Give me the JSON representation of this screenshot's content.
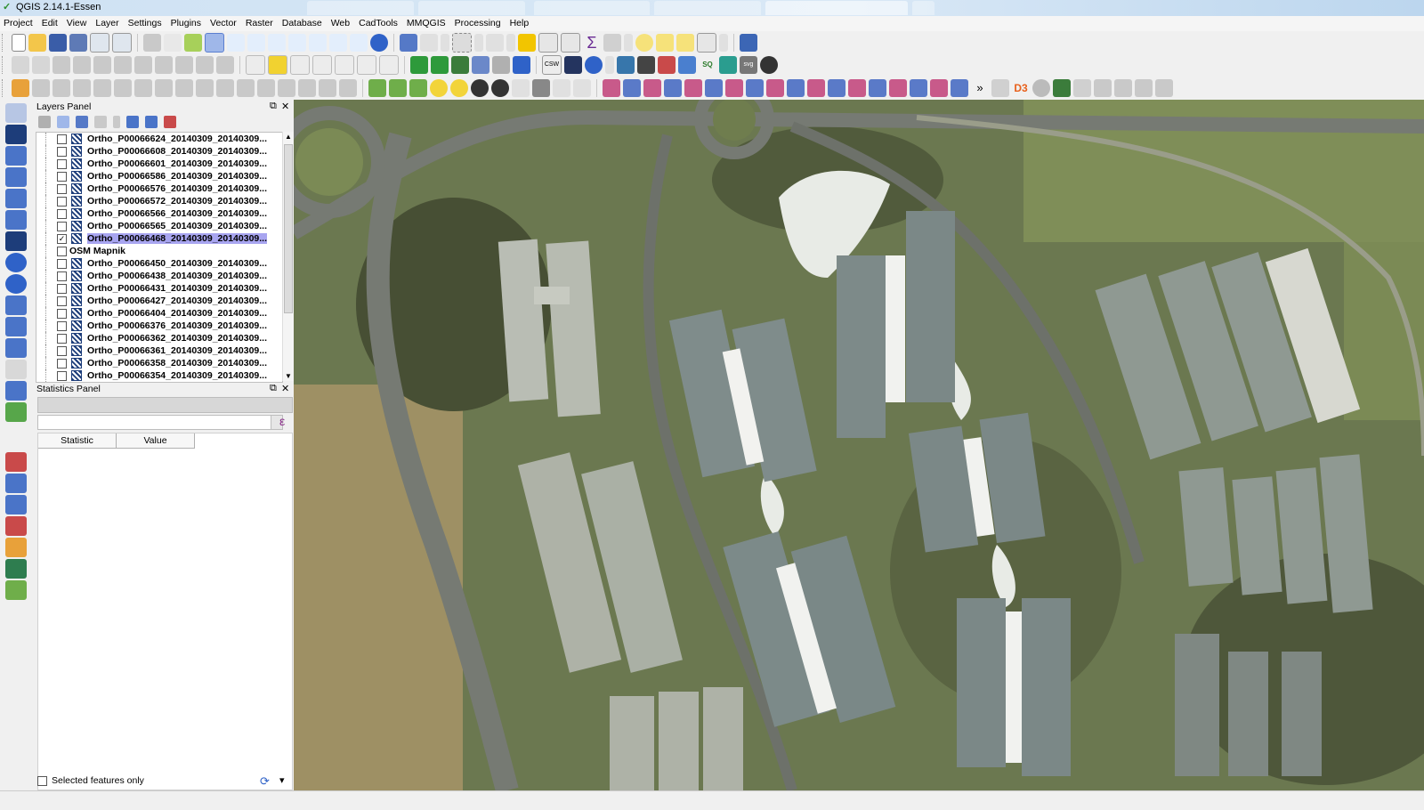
{
  "window": {
    "title": "QGIS 2.14.1-Essen"
  },
  "menu": [
    "Project",
    "Edit",
    "View",
    "Layer",
    "Settings",
    "Plugins",
    "Vector",
    "Raster",
    "Database",
    "Web",
    "CadTools",
    "MMQGIS",
    "Processing",
    "Help"
  ],
  "layers_panel": {
    "title": "Layers Panel",
    "layers": [
      {
        "name": "Ortho_P00066624_20140309_20140309...",
        "checked": false,
        "type": "raster"
      },
      {
        "name": "Ortho_P00066608_20140309_20140309...",
        "checked": false,
        "type": "raster"
      },
      {
        "name": "Ortho_P00066601_20140309_20140309...",
        "checked": false,
        "type": "raster"
      },
      {
        "name": "Ortho_P00066586_20140309_20140309...",
        "checked": false,
        "type": "raster"
      },
      {
        "name": "Ortho_P00066576_20140309_20140309...",
        "checked": false,
        "type": "raster"
      },
      {
        "name": "Ortho_P00066572_20140309_20140309...",
        "checked": false,
        "type": "raster"
      },
      {
        "name": "Ortho_P00066566_20140309_20140309...",
        "checked": false,
        "type": "raster"
      },
      {
        "name": "Ortho_P00066565_20140309_20140309...",
        "checked": false,
        "type": "raster"
      },
      {
        "name": "Ortho_P00066468_20140309_20140309...",
        "checked": true,
        "type": "raster",
        "selected": true
      },
      {
        "name": "OSM Mapnik",
        "checked": false,
        "type": "group"
      },
      {
        "name": "Ortho_P00066450_20140309_20140309...",
        "checked": false,
        "type": "raster"
      },
      {
        "name": "Ortho_P00066438_20140309_20140309...",
        "checked": false,
        "type": "raster"
      },
      {
        "name": "Ortho_P00066431_20140309_20140309...",
        "checked": false,
        "type": "raster"
      },
      {
        "name": "Ortho_P00066427_20140309_20140309...",
        "checked": false,
        "type": "raster"
      },
      {
        "name": "Ortho_P00066404_20140309_20140309...",
        "checked": false,
        "type": "raster"
      },
      {
        "name": "Ortho_P00066376_20140309_20140309...",
        "checked": false,
        "type": "raster"
      },
      {
        "name": "Ortho_P00066362_20140309_20140309...",
        "checked": false,
        "type": "raster"
      },
      {
        "name": "Ortho_P00066361_20140309_20140309...",
        "checked": false,
        "type": "raster"
      },
      {
        "name": "Ortho_P00066358_20140309_20140309...",
        "checked": false,
        "type": "raster"
      },
      {
        "name": "Ortho_P00066354_20140309_20140309...",
        "checked": false,
        "type": "raster"
      }
    ]
  },
  "statistics_panel": {
    "title": "Statistics Panel",
    "columns": [
      "Statistic",
      "Value"
    ],
    "selected_only_label": "Selected features only",
    "selected_only_checked": false,
    "expression_icon": "ε"
  },
  "toolbar_glyphs": {
    "overflow": "»",
    "cadtools_label": "D3",
    "sql": "SQ",
    "svg": "svg",
    "csw": "CSW"
  },
  "colors": {
    "selected_layer_bg": "#a8a5f0",
    "accent_blue": "#2f62c8"
  }
}
